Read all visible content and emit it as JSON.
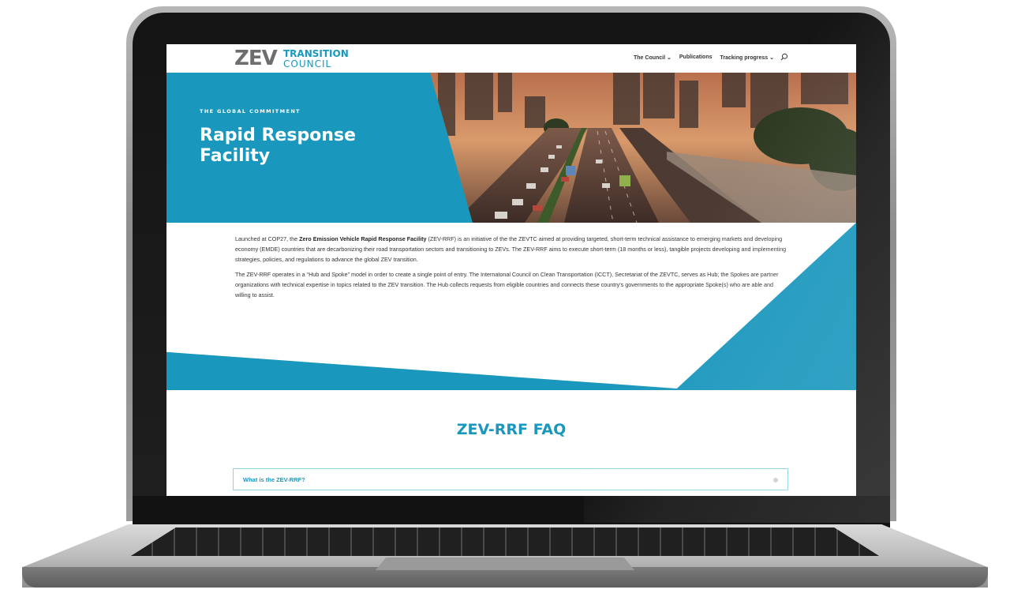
{
  "brand": {
    "logo_main": "ZEV",
    "logo_line1": "TRANSITION",
    "logo_line2": "COUNCIL"
  },
  "nav": {
    "items": [
      {
        "label": "The Council ⌄"
      },
      {
        "label": "Publications"
      },
      {
        "label": "Tracking progress ⌄"
      }
    ],
    "search_icon": "search-icon"
  },
  "hero": {
    "kicker": "THE GLOBAL COMMITMENT",
    "title": "Rapid Response Facility"
  },
  "intro": {
    "p1_pre": "Launched at COP27, the ",
    "p1_bold": "Zero Emission Vehicle Rapid Response Facility",
    "p1_post": " (ZEV-RRF) is an initiative of the the ZEVTC aimed at providing targeted, short-term technical assistance to emerging markets and developing economy (EMDE) countries that are decarbonizing their road transportation sectors and transitioning to ZEVs. The ZEV-RRF aims to execute short-term (18 months or less), tangible projects developing and implementing strategies, policies, and regulations to advance the global ZEV transition.",
    "p2": "The ZEV-RRF operates in a “Hub and Spoke” model in order to create a single point of entry. The Internatonal Council on Clean Transportation (ICCT), Secretariat of the ZEVTC, serves as Hub; the Spokes are partner organizations with technical expertise in topics related to the ZEV transition. The Hub collects requests from eligible countries and connects these country's governments to the appropriate Spoke(s) who are able and willing to assist."
  },
  "faq": {
    "title": "ZEV-RRF FAQ",
    "items": [
      {
        "question": "What is the ZEV-RRF?"
      }
    ]
  },
  "colors": {
    "accent": "#1a97bd",
    "text": "#333333",
    "logo_gray": "#6e6e6e"
  }
}
